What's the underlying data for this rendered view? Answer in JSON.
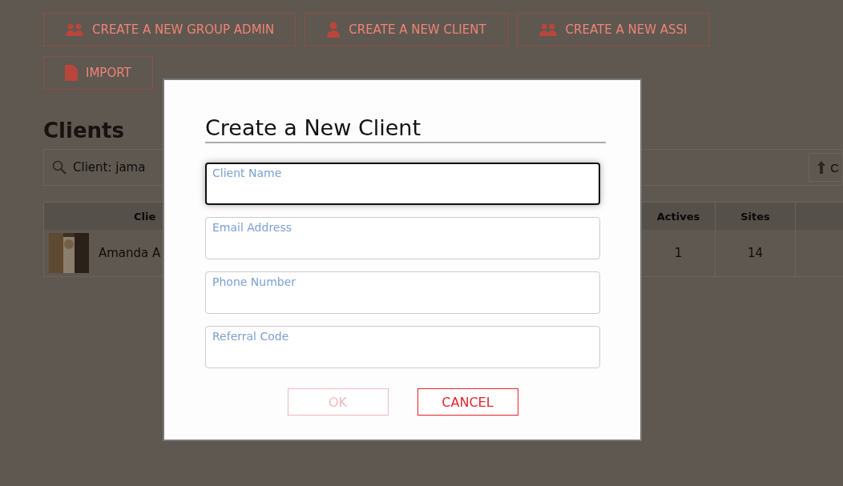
{
  "toolbar": {
    "buttons": [
      {
        "label": "CREATE A NEW GROUP ADMIN"
      },
      {
        "label": "CREATE A NEW CLIENT"
      },
      {
        "label": "CREATE A NEW ASSI"
      },
      {
        "label": "IMPORT"
      }
    ]
  },
  "section_title": "Clients",
  "search": {
    "value": "Client: jama"
  },
  "filter_button": {
    "label": "C"
  },
  "table": {
    "columns": [
      "Clie",
      "Actives",
      "Sites"
    ],
    "rows": [
      {
        "name": "Amanda A",
        "actives": "1",
        "sites": "14"
      }
    ]
  },
  "dialog": {
    "title": "Create a New Client",
    "fields": [
      {
        "label": "Client Name",
        "focused": true
      },
      {
        "label": "Email Address",
        "focused": false
      },
      {
        "label": "Phone Number",
        "focused": false
      },
      {
        "label": "Referral Code",
        "focused": false
      }
    ],
    "buttons": [
      {
        "label": "OK",
        "disabled": true
      },
      {
        "label": "CANCEL",
        "disabled": false
      }
    ]
  }
}
